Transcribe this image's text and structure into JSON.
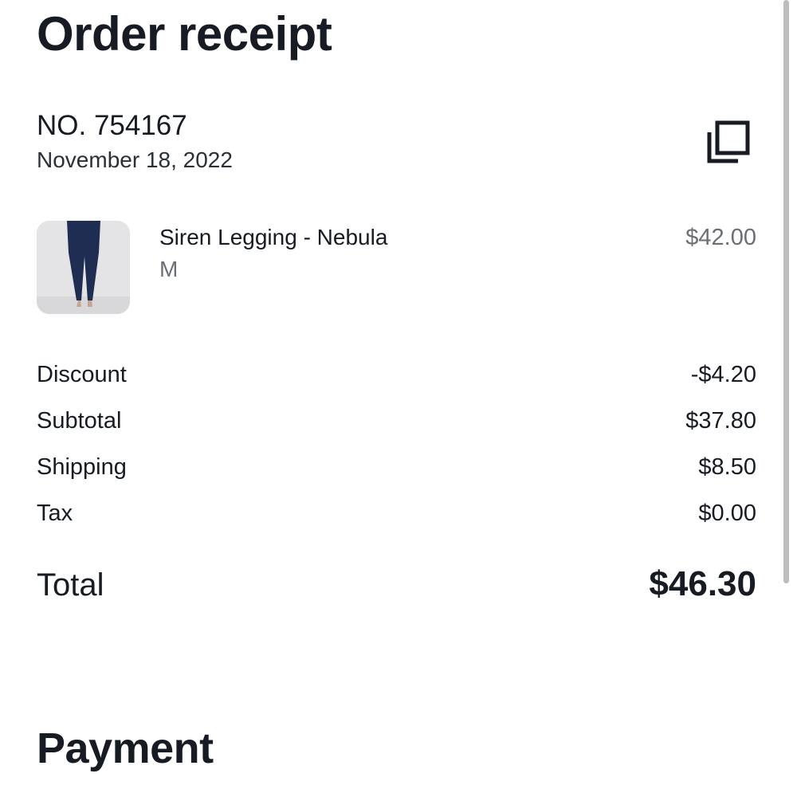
{
  "header": {
    "title": "Order receipt"
  },
  "order": {
    "number": "NO. 754167",
    "date": "November 18, 2022"
  },
  "icons": {
    "copy": "copy-icon"
  },
  "item": {
    "name": "Siren Legging - Nebula",
    "size": "M",
    "price": "$42.00",
    "image_alt": "Navy leggings on model",
    "product_color": "#1f2d52"
  },
  "summary": [
    {
      "label": "Discount",
      "value": "-$4.20"
    },
    {
      "label": "Subtotal",
      "value": "$37.80"
    },
    {
      "label": "Shipping",
      "value": "$8.50"
    },
    {
      "label": "Tax",
      "value": "$0.00"
    }
  ],
  "total": {
    "label": "Total",
    "value": "$46.30"
  },
  "payment": {
    "heading": "Payment"
  },
  "colors": {
    "text_primary": "#161b24",
    "text_secondary": "#6a6e75",
    "background": "#ffffff"
  }
}
